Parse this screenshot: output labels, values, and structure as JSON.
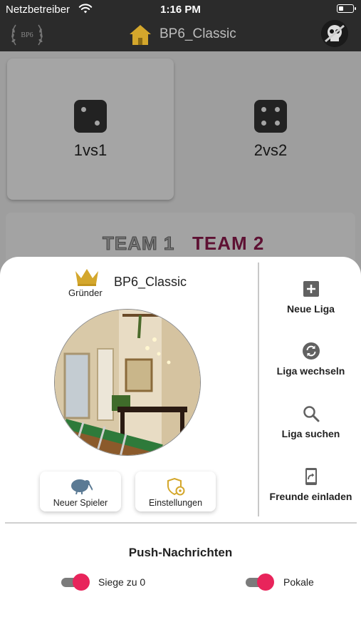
{
  "status": {
    "carrier": "Netzbetreiber",
    "time": "1:16 PM"
  },
  "header": {
    "logo_text": "BP6",
    "title": "BP6_Classic"
  },
  "modes": [
    {
      "label": "1vs1"
    },
    {
      "label": "2vs2"
    }
  ],
  "teams": {
    "team1": "TEAM 1",
    "team2": "TEAM 2"
  },
  "sheet": {
    "role": "Gründer",
    "league_name": "BP6_Classic",
    "buttons": {
      "new_player": "Neuer Spieler",
      "settings": "Einstellungen"
    },
    "side_menu": {
      "new_league": "Neue Liga",
      "switch_league": "Liga wechseln",
      "search_league": "Liga suchen",
      "invite_friends": "Freunde einladen"
    },
    "push": {
      "title": "Push-Nachrichten",
      "toggles": [
        {
          "label": "Siege zu 0",
          "on": true
        },
        {
          "label": "Pokale",
          "on": true
        }
      ]
    }
  },
  "colors": {
    "accent": "#e8245b",
    "gold": "#d4a72c",
    "team2": "#8c1a4d",
    "topbar": "#2b2b2b"
  },
  "icons": {
    "home": "home-icon",
    "crown": "crown-icon",
    "kiwi": "kiwi-bird-icon",
    "shield": "shield-gear-icon",
    "plus": "plus-square-icon",
    "swap": "sync-icon",
    "search": "search-icon",
    "share": "share-phone-icon"
  }
}
